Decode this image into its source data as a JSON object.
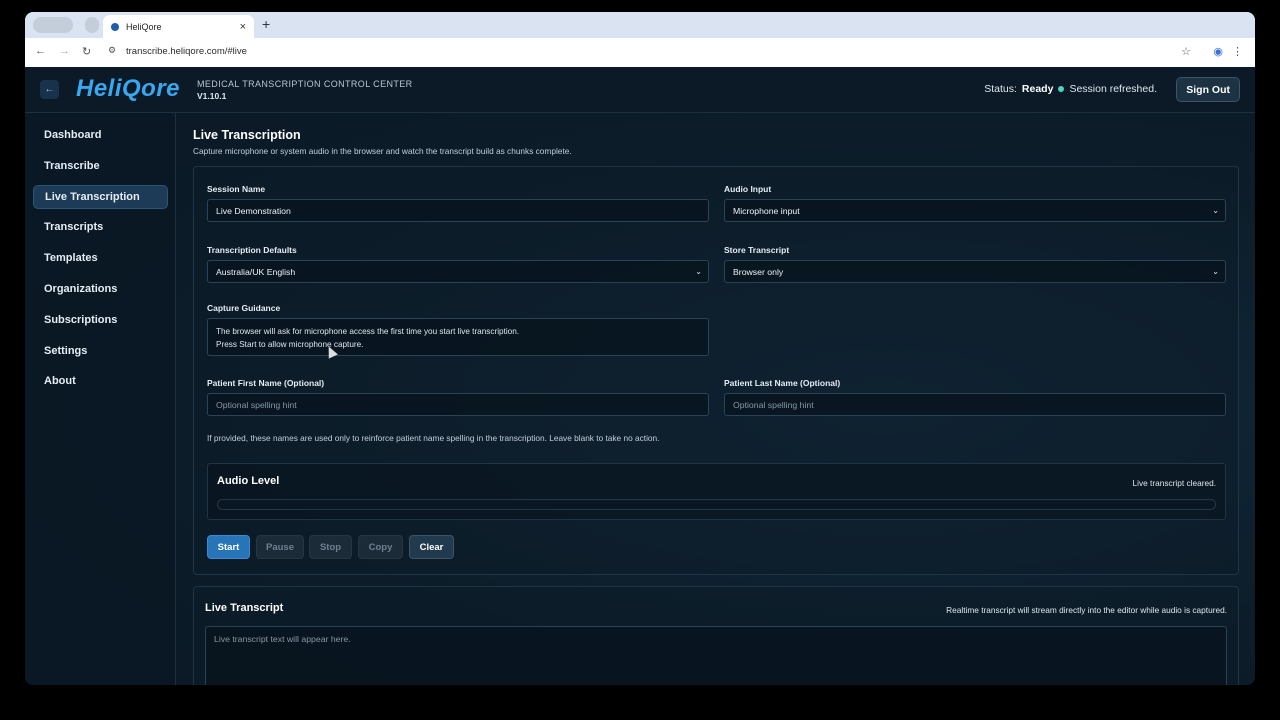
{
  "browser": {
    "tab_title": "HeliQore",
    "tab_close": "×",
    "new_tab": "+",
    "url": "transcribe.heliqore.com/#live"
  },
  "header": {
    "logo": "HeliQore",
    "title": "MEDICAL TRANSCRIPTION CONTROL CENTER",
    "version": "V1.10.1",
    "status_label": "Status:",
    "status_value": "Ready",
    "session_msg": "Session refreshed.",
    "sign_out": "Sign Out"
  },
  "sidebar": {
    "items": [
      {
        "label": "Dashboard"
      },
      {
        "label": "Transcribe"
      },
      {
        "label": "Live Transcription"
      },
      {
        "label": "Transcripts"
      },
      {
        "label": "Templates"
      },
      {
        "label": "Organizations"
      },
      {
        "label": "Subscriptions"
      },
      {
        "label": "Settings"
      },
      {
        "label": "About"
      }
    ],
    "active_index": 2
  },
  "page": {
    "title": "Live Transcription",
    "subtitle": "Capture microphone or system audio in the browser and watch the transcript build as chunks complete."
  },
  "form": {
    "session_name_label": "Session Name",
    "session_name_value": "Live Demonstration",
    "audio_input_label": "Audio Input",
    "audio_input_value": "Microphone input",
    "defaults_label": "Transcription Defaults",
    "defaults_value": "Australia/UK English",
    "store_label": "Store Transcript",
    "store_value": "Browser only",
    "guidance_label": "Capture Guidance",
    "guidance_line1": "The browser will ask for microphone access the first time you start live transcription.",
    "guidance_line2": "Press Start to allow microphone capture.",
    "first_name_label": "Patient First Name (Optional)",
    "first_name_placeholder": "Optional spelling hint",
    "last_name_label": "Patient Last Name (Optional)",
    "last_name_placeholder": "Optional spelling hint",
    "names_note": "If provided, these names are used only to reinforce patient name spelling in the transcription. Leave blank to take no action."
  },
  "audio": {
    "title": "Audio Level",
    "status": "Live transcript cleared.",
    "level_percent": 0
  },
  "controls": {
    "start": "Start",
    "pause": "Pause",
    "stop": "Stop",
    "copy": "Copy",
    "clear": "Clear"
  },
  "transcript": {
    "title": "Live Transcript",
    "hint": "Realtime transcript will stream directly into the editor while audio is captured.",
    "placeholder": "Live transcript text will appear here."
  },
  "colors": {
    "accent": "#2874b8",
    "status_dot": "#4fd1c5",
    "background": "#0b1a26"
  }
}
